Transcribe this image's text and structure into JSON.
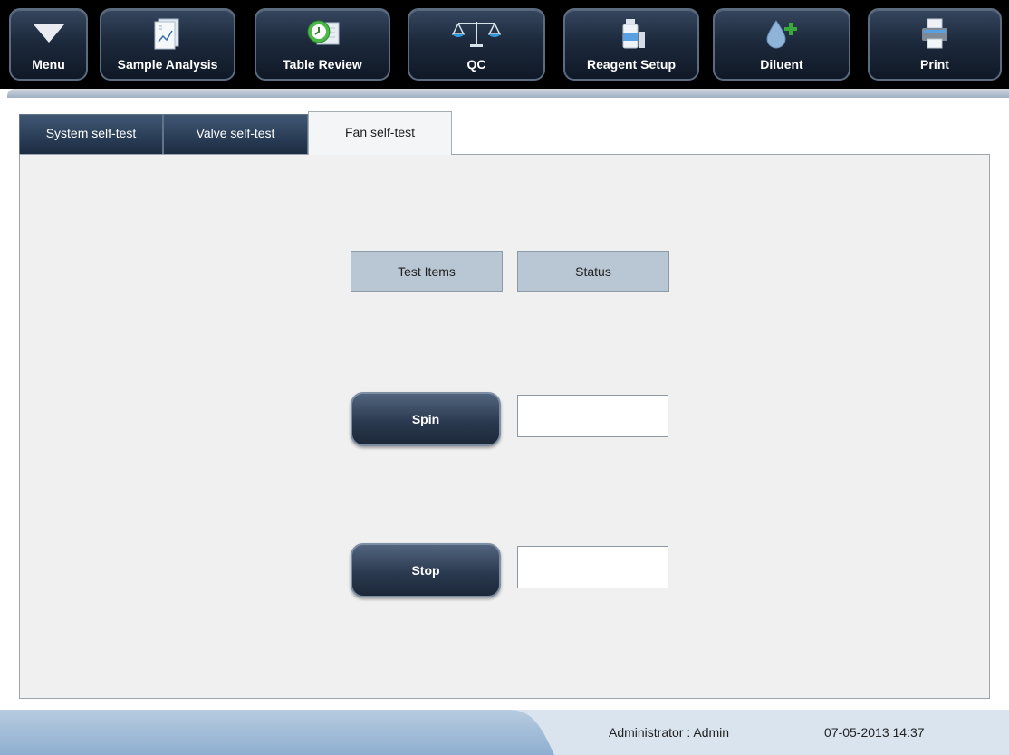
{
  "toolbar": {
    "buttons": [
      {
        "label": "Menu",
        "icon": "triangle-down-icon"
      },
      {
        "label": "Sample Analysis",
        "icon": "document-chart-icon"
      },
      {
        "label": "Table Review",
        "icon": "clock-table-icon"
      },
      {
        "label": "QC",
        "icon": "balance-scale-icon"
      },
      {
        "label": "Reagent Setup",
        "icon": "reagent-bottle-icon"
      },
      {
        "label": "Diluent",
        "icon": "drop-plus-icon"
      },
      {
        "label": "Print",
        "icon": "printer-icon"
      }
    ]
  },
  "tabs": [
    {
      "label": "System self-test",
      "active": false
    },
    {
      "label": "Valve self-test",
      "active": false
    },
    {
      "label": "Fan self-test",
      "active": true
    }
  ],
  "table": {
    "headers": [
      "Test Items",
      "Status"
    ],
    "rows": [
      {
        "action": "Spin",
        "status": ""
      },
      {
        "action": "Stop",
        "status": ""
      }
    ]
  },
  "statusbar": {
    "user": "Administrator : Admin",
    "datetime": "07-05-2013 14:37"
  },
  "colors": {
    "toolbar_bg": "#000000",
    "button_dark": "#1d2a3d",
    "panel_bg": "#f0f0f0",
    "header_cell": "#b9c6d3",
    "statusbar_bg": "#d9e4ef",
    "diluent_green": "#3aa83a"
  }
}
